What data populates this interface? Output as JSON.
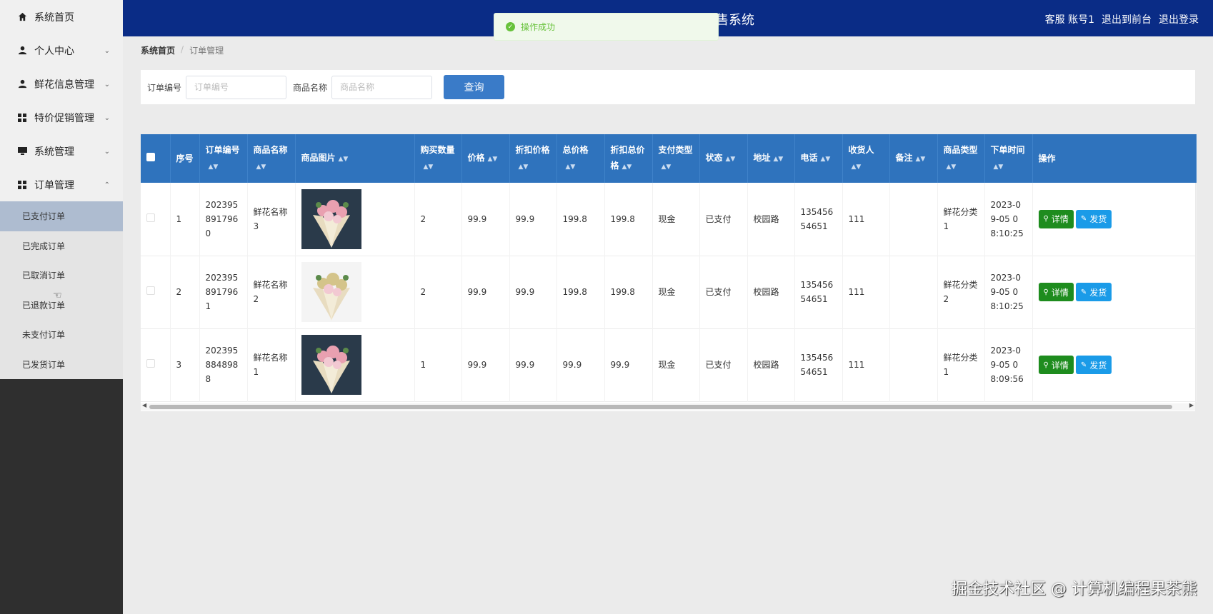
{
  "sidebar": {
    "home": "系统首页",
    "personal": "个人中心",
    "flower_info": "鲜花信息管理",
    "promo": "特价促销管理",
    "system": "系统管理",
    "orders": "订单管理",
    "sub": [
      "已支付订单",
      "已完成订单",
      "已取消订单",
      "已退款订单",
      "未支付订单",
      "已发货订单"
    ]
  },
  "header": {
    "title": "售系统",
    "service": "客服 账号1",
    "front": "退出到前台",
    "logout": "退出登录"
  },
  "toast": {
    "text": "操作成功"
  },
  "breadcrumb": {
    "home": "系统首页",
    "current": "订单管理"
  },
  "search": {
    "order_label": "订单编号",
    "order_placeholder": "订单编号",
    "name_label": "商品名称",
    "name_placeholder": "商品名称",
    "button": "查询"
  },
  "table": {
    "headers": {
      "index": "序号",
      "order_no": "订单编号",
      "name": "商品名称",
      "image": "商品图片",
      "qty": "购买数量",
      "price": "价格",
      "disc_price": "折扣价格",
      "total": "总价格",
      "disc_total": "折扣总价格",
      "pay_type": "支付类型",
      "status": "状态",
      "address": "地址",
      "phone": "电话",
      "receiver": "收货人",
      "remark": "备注",
      "category": "商品类型",
      "time": "下单时间",
      "action": "操作"
    },
    "rows": [
      {
        "index": "1",
        "order_no": "2023958917960",
        "name": "鲜花名称3",
        "qty": "2",
        "price": "99.9",
        "disc_price": "99.9",
        "total": "199.8",
        "disc_total": "199.8",
        "pay_type": "现金",
        "status": "已支付",
        "address": "校园路",
        "phone": "13545654651",
        "receiver": "111",
        "remark": "",
        "category": "鲜花分类1",
        "time": "2023-09-05 08:10:25",
        "flower_color": "#e9a0b0",
        "bg_color": "#2a3a4a"
      },
      {
        "index": "2",
        "order_no": "2023958917961",
        "name": "鲜花名称2",
        "qty": "2",
        "price": "99.9",
        "disc_price": "99.9",
        "total": "199.8",
        "disc_total": "199.8",
        "pay_type": "现金",
        "status": "已支付",
        "address": "校园路",
        "phone": "13545654651",
        "receiver": "111",
        "remark": "",
        "category": "鲜花分类2",
        "time": "2023-09-05 08:10:25",
        "flower_color": "#d4c48a",
        "bg_color": "#f4f4f4"
      },
      {
        "index": "3",
        "order_no": "2023958848988",
        "name": "鲜花名称1",
        "qty": "1",
        "price": "99.9",
        "disc_price": "99.9",
        "total": "99.9",
        "disc_total": "99.9",
        "pay_type": "现金",
        "status": "已支付",
        "address": "校园路",
        "phone": "13545654651",
        "receiver": "111",
        "remark": "",
        "category": "鲜花分类1",
        "time": "2023-09-05 08:09:56",
        "flower_color": "#e9a0b0",
        "bg_color": "#2a3a4a"
      }
    ],
    "detail_btn": "详情",
    "ship_btn": "发货"
  },
  "watermark": "掘金技术社区 @ 计算机编程果茶熊"
}
